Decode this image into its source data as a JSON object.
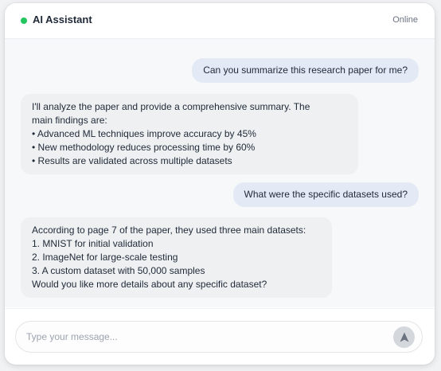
{
  "header": {
    "title": "AI Assistant",
    "status": "Online",
    "status_color": "#22c55e"
  },
  "messages": [
    {
      "role": "user",
      "lines": [
        "Can you summarize this research paper for me?"
      ]
    },
    {
      "role": "assistant",
      "lines": [
        "I'll analyze the paper and provide a comprehensive summary. The",
        "main findings are:",
        "• Advanced ML techniques improve accuracy by 45%",
        "• New methodology reduces processing time by 60%",
        "• Results are validated across multiple datasets"
      ]
    },
    {
      "role": "user",
      "lines": [
        "What were the specific datasets used?"
      ]
    },
    {
      "role": "assistant",
      "lines": [
        "According to page 7 of the paper, they used three main datasets:",
        "1. MNIST for initial validation",
        "2. ImageNet for large-scale testing",
        "3. A custom dataset with 50,000 samples",
        "Would you like more details about any specific dataset?"
      ]
    }
  ],
  "composer": {
    "placeholder": "Type your message...",
    "value": "",
    "send_icon": "send-arrow-icon"
  },
  "colors": {
    "user_bubble": "#e4e9f6",
    "assistant_bubble": "#eef0f2",
    "send_button": "#d4d8dd"
  }
}
